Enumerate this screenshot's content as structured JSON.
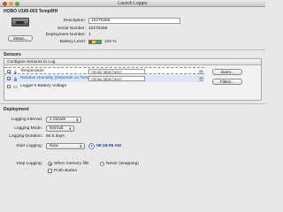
{
  "window": {
    "title": "Launch Logger"
  },
  "device": {
    "title": "HOBO U100-003 Temp/RH",
    "status_button": "Status...",
    "description_label": "Description:",
    "description_value": "10270266",
    "serial_label": "Serial Number:",
    "serial_value": "10270266",
    "deployment_label": "Deployment Number:",
    "deployment_value": "1",
    "battery_label": "Battery Level:",
    "battery_value": "100 %",
    "battery_level_fraction": 1.0
  },
  "sensors": {
    "section_title": "Sensors",
    "panel_title": "Configure Sensors to Log",
    "items": [
      {
        "name": "Temperature",
        "placeholder": "<Enter label here>",
        "checked": true,
        "selected": true
      },
      {
        "name": "Relative Humidity (Depends on Temp Channel 1)",
        "placeholder": "<Enter label here>",
        "checked": true,
        "selected": false
      },
      {
        "name": "Logger's Battery Voltage",
        "checked": false,
        "selected": false
      }
    ],
    "alarms_button": "Alarm...",
    "filters_button": "Filters..."
  },
  "deployment": {
    "section_title": "Deployment",
    "interval_label": "Logging Interval:",
    "interval_value": "1 minute",
    "mode_label": "Logging Mode:",
    "mode_value": "Normal",
    "duration_label": "Logging Duration:",
    "duration_value": "60.5 days",
    "start_label": "Start Logging:",
    "start_value": "Now",
    "start_time": "09:18:09 AM",
    "stop_label": "Stop Logging:",
    "stop_options": [
      {
        "label": "When memory fills",
        "selected": true
      },
      {
        "label": "Never (wrapping)",
        "selected": false
      }
    ],
    "push_button_label": "Push Button"
  },
  "colors": {
    "selection_blue": "#dce6f7",
    "battery_green": "#3fb03f",
    "battery_yellow": "#e8d23a",
    "battery_red": "#d93a2a",
    "time_blue": "#1a3fb0"
  }
}
